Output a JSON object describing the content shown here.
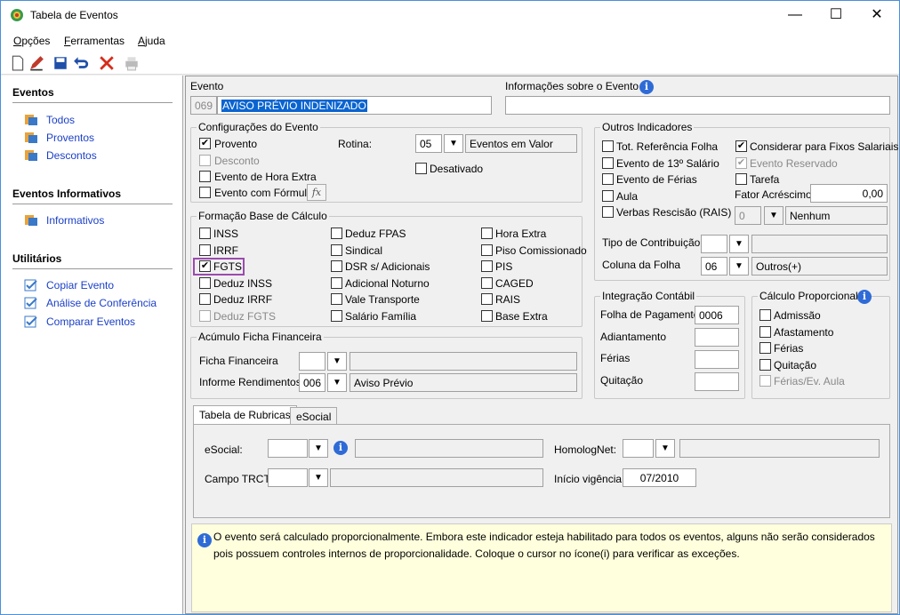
{
  "window": {
    "title": "Tabela de Eventos"
  },
  "menu": [
    "Opções",
    "Ferramentas",
    "Ajuda"
  ],
  "sidebar": {
    "sections": [
      {
        "heading": "Eventos",
        "items": [
          "Todos",
          "Proventos",
          "Descontos"
        ]
      },
      {
        "heading": "Eventos Informativos",
        "items": [
          "Informativos"
        ]
      },
      {
        "heading": "Utilitários",
        "items": [
          "Copiar Evento",
          "Análise de Conferência",
          "Comparar Eventos"
        ]
      }
    ]
  },
  "evento": {
    "label": "Evento",
    "code": "069",
    "name": "AVISO PRÉVIO INDENIZADO",
    "info_label": "Informações sobre o Evento",
    "info_value": ""
  },
  "config": {
    "title": "Configurações do Evento",
    "provento": "Provento",
    "desconto": "Desconto",
    "hora_extra": "Evento de Hora Extra",
    "formula": "Evento com Fórmula",
    "rotina_label": "Rotina:",
    "rotina_code": "05",
    "rotina_desc": "Eventos em Valor",
    "desativado": "Desativado",
    "fx": "fx"
  },
  "formacao": {
    "title": "Formação Base de Cálculo",
    "col1": [
      "INSS",
      "IRRF",
      "FGTS",
      "Deduz INSS",
      "Deduz IRRF",
      "Deduz FGTS"
    ],
    "col2": [
      "Deduz FPAS",
      "Sindical",
      "DSR s/ Adicionais",
      "Adicional Noturno",
      "Vale Transporte",
      "Salário Família"
    ],
    "col3": [
      "Hora Extra",
      "Piso Comissionado",
      "PIS",
      "CAGED",
      "RAIS",
      "Base Extra"
    ]
  },
  "acumulo": {
    "title": "Acúmulo Ficha Financeira",
    "ficha_label": "Ficha Financeira",
    "ficha_code": "",
    "informe_label": "Informe Rendimentos",
    "informe_code": "006",
    "informe_desc": "Aviso Prévio"
  },
  "outros": {
    "title": "Outros Indicadores",
    "tot_ref": "Tot. Referência Folha",
    "evento13": "Evento de 13º Salário",
    "ferias": "Evento de Férias",
    "aula": "Aula",
    "verbas": "Verbas Rescisão (RAIS)",
    "considerar": "Considerar para Fixos Salariais",
    "reservado": "Evento Reservado",
    "tarefa": "Tarefa",
    "fator_label": "Fator Acréscimo",
    "fator_value": "0,00",
    "verbas_code": "0",
    "verbas_desc": "Nenhum",
    "tipo_contrib_label": "Tipo de Contribuição",
    "coluna_label": "Coluna da Folha",
    "coluna_code": "06",
    "coluna_desc": "Outros(+)"
  },
  "integracao": {
    "title": "Integração Contábil",
    "folha_label": "Folha de Pagamento",
    "folha_value": "0006",
    "adiantamento": "Adiantamento",
    "ferias": "Férias",
    "quitacao": "Quitação"
  },
  "proporcional": {
    "title": "Cálculo Proporcional",
    "items": [
      "Admissão",
      "Afastamento",
      "Férias",
      "Quitação",
      "Férias/Ev. Aula"
    ]
  },
  "tabs": {
    "rubricas": "Tabela de Rubricas",
    "esocial": "eSocial"
  },
  "rubricas": {
    "esocial_label": "eSocial:",
    "homolog_label": "HomologNet:",
    "campo_trct_label": "Campo TRCT:",
    "inicio_label": "Início vigência:",
    "inicio_value": "07/2010"
  },
  "footer": {
    "text": "O evento será calculado proporcionalmente. Embora este indicador esteja habilitado para todos os eventos, alguns não serão considerados pois possuem controles internos de proporcionalidade. Coloque o cursor no ícone(i) para verificar as exceções."
  }
}
